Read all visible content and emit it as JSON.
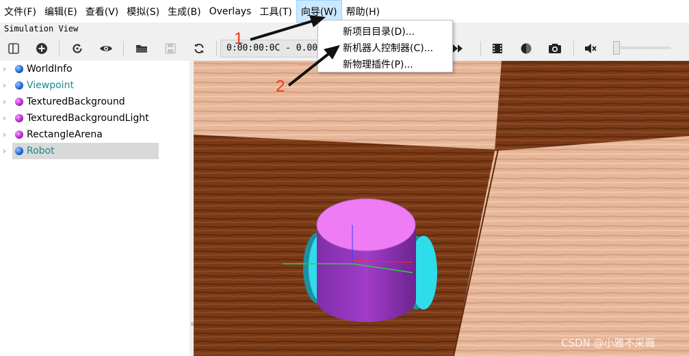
{
  "menubar": {
    "items": [
      {
        "label": "文件(F)"
      },
      {
        "label": "编辑(E)"
      },
      {
        "label": "查看(V)"
      },
      {
        "label": "模拟(S)"
      },
      {
        "label": "生成(B)"
      },
      {
        "label": "Overlays"
      },
      {
        "label": "工具(T)"
      },
      {
        "label": "向导(W)",
        "active": true
      },
      {
        "label": "帮助(H)"
      }
    ]
  },
  "view_title": "Simulation View",
  "toolbar": {
    "time_display": "0:00:00:0C -  0.00",
    "buttons": [
      "toggle-tree-icon",
      "add-node-icon",
      "reset-simulation-icon",
      "view-eye-icon",
      "open-folder-icon",
      "save-icon",
      "reload-icon",
      "fast-forward-icon",
      "film-record-icon",
      "render-mode-icon",
      "screenshot-camera-icon",
      "mute-speaker-icon"
    ],
    "volume_level": 0.0
  },
  "wizard_menu": {
    "items": [
      {
        "label": "新项目目录(D)..."
      },
      {
        "label": "新机器人控制器(C)..."
      },
      {
        "label": "新物理插件(P)..."
      }
    ]
  },
  "scene_tree": {
    "items": [
      {
        "label": "WorldInfo",
        "color": "blue"
      },
      {
        "label": "Viewpoint",
        "color": "blue",
        "teal": true
      },
      {
        "label": "TexturedBackground",
        "color": "purple"
      },
      {
        "label": "TexturedBackgroundLight",
        "color": "purple"
      },
      {
        "label": "RectangleArena",
        "color": "purple"
      },
      {
        "label": "Robot",
        "color": "blue",
        "teal": true,
        "selected": true
      }
    ]
  },
  "annotations": {
    "step1": "1",
    "step2": "2"
  },
  "watermark": "CSDN @小雅不采薇",
  "colors": {
    "menu_active": "#cce8ff",
    "annotation": "#e83a17",
    "tree_teal": "#1a8a8c",
    "robot_body": "#ee7df5",
    "robot_wheel": "#2fdcea"
  }
}
